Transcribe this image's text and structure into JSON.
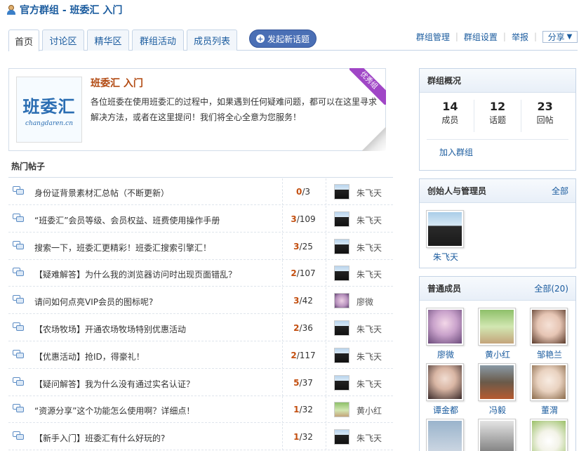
{
  "header": {
    "title": "官方群组 - 班委汇  入门"
  },
  "tabs": [
    {
      "label": "首页",
      "active": true
    },
    {
      "label": "讨论区",
      "active": false
    },
    {
      "label": "精华区",
      "active": false
    },
    {
      "label": "群组活动",
      "active": false
    },
    {
      "label": "成员列表",
      "active": false
    }
  ],
  "new_topic_label": "发起新话题",
  "top_links": {
    "manage": "群组管理",
    "settings": "群组设置",
    "report": "举报",
    "share": "分享"
  },
  "group": {
    "logo_main": "班委汇",
    "logo_sub": "changdaren.cn",
    "ribbon": "优秀组",
    "name": "班委汇  入门",
    "description": "各位班委在使用班委汇的过程中，如果遇到任何疑难问题，都可以在这里寻求解决方法，或者在这里提问！我们将全心全意为您服务！"
  },
  "hot_posts": {
    "title": "热门帖子",
    "items": [
      {
        "title": "身份证背景素材汇总帖（不断更新）",
        "replies": "0",
        "views": "3",
        "author": "朱飞天",
        "avatar": "zhu"
      },
      {
        "title": "“班委汇”会员等级、会员权益、班费使用操作手册",
        "replies": "3",
        "views": "109",
        "author": "朱飞天",
        "avatar": "zhu"
      },
      {
        "title": "搜索一下，班委汇更精彩！班委汇搜索引擎汇！",
        "replies": "3",
        "views": "25",
        "author": "朱飞天",
        "avatar": "zhu"
      },
      {
        "title": "【疑难解答】为什么我的浏览器访问时出现页面错乱？",
        "replies": "2",
        "views": "107",
        "author": "朱飞天",
        "avatar": "zhu"
      },
      {
        "title": "请问如何点亮VIP会员的图标呢?",
        "replies": "3",
        "views": "42",
        "author": "廖微",
        "avatar": "liao"
      },
      {
        "title": "【农场牧场】开通农场牧场特别优惠活动",
        "replies": "2",
        "views": "36",
        "author": "朱飞天",
        "avatar": "zhu"
      },
      {
        "title": "【优惠活动】抢ID，得豪礼！",
        "replies": "2",
        "views": "117",
        "author": "朱飞天",
        "avatar": "zhu"
      },
      {
        "title": "【疑问解答】我为什么没有通过实名认证？",
        "replies": "5",
        "views": "37",
        "author": "朱飞天",
        "avatar": "zhu"
      },
      {
        "title": "“资源分享”这个功能怎么使用啊？详细点！",
        "replies": "1",
        "views": "32",
        "author": "黄小红",
        "avatar": "huang"
      },
      {
        "title": "【新手入门】班委汇有什么好玩的?",
        "replies": "1",
        "views": "32",
        "author": "朱飞天",
        "avatar": "zhu"
      }
    ]
  },
  "overview": {
    "title": "群组概况",
    "stats": [
      {
        "num": "14",
        "label": "成员"
      },
      {
        "num": "12",
        "label": "话题"
      },
      {
        "num": "23",
        "label": "回帖"
      }
    ],
    "join_label": "加入群组"
  },
  "admins": {
    "title": "创始人与管理员",
    "more": "全部",
    "members": [
      {
        "name": "朱飞天",
        "avatar": "zhu"
      }
    ]
  },
  "members": {
    "title": "普通成员",
    "more": "全部(20)",
    "list": [
      {
        "name": "廖微",
        "avatar": "liao"
      },
      {
        "name": "黄小红",
        "avatar": "huang"
      },
      {
        "name": "邹艳兰",
        "avatar": "zou"
      },
      {
        "name": "谭金都",
        "avatar": "tan"
      },
      {
        "name": "冯毅",
        "avatar": "feng"
      },
      {
        "name": "董渭",
        "avatar": "dong"
      },
      {
        "name": "",
        "avatar": "r3a"
      },
      {
        "name": "",
        "avatar": "r3b"
      },
      {
        "name": "",
        "avatar": "r3c"
      }
    ]
  }
}
